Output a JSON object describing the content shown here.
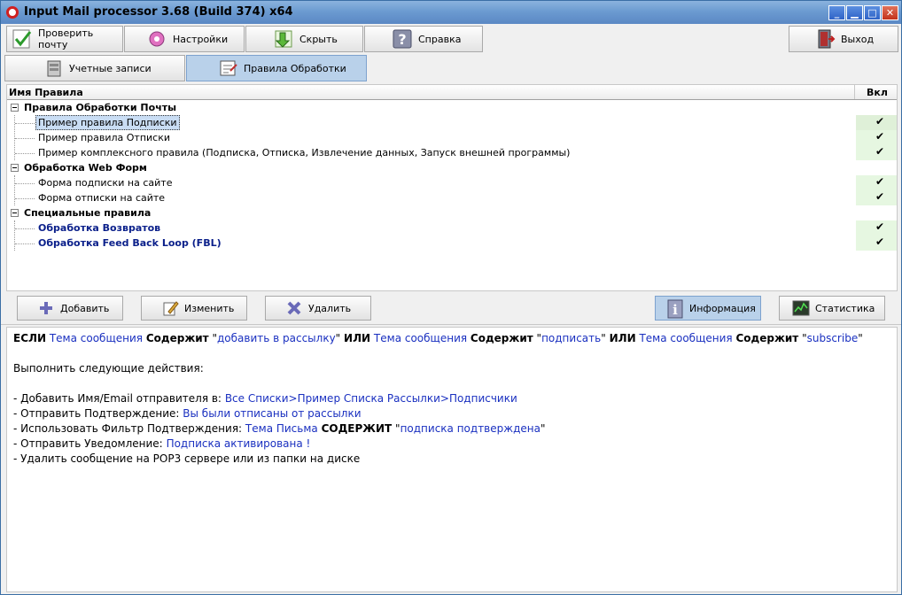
{
  "window": {
    "title": "Input Mail processor 3.68 (Build 374) x64",
    "controls": {
      "minimize": "_",
      "maximize": "□",
      "close": "✕"
    }
  },
  "toolbar": {
    "check_mail": "Проверить почту",
    "settings": "Настройки",
    "hide": "Скрыть",
    "help": "Справка",
    "exit": "Выход"
  },
  "tabs": [
    {
      "label": "Учетные записи",
      "active": false
    },
    {
      "label": "Правила Обработки",
      "active": true
    }
  ],
  "list": {
    "header": {
      "name": "Имя Правила",
      "enabled": "Вкл"
    },
    "rows": [
      {
        "kind": "group",
        "label": "Правила Обработки Почты"
      },
      {
        "kind": "child",
        "label": "Пример правила Подписки",
        "checked": true,
        "selected": true
      },
      {
        "kind": "child",
        "label": "Пример правила Отписки",
        "checked": true
      },
      {
        "kind": "child",
        "label": "Пример комплексного правила (Подписка, Отписка, Извлечение данных, Запуск внешней программы)",
        "checked": true
      },
      {
        "kind": "group",
        "label": "Обработка Web Форм"
      },
      {
        "kind": "child",
        "label": "Форма подписки на сайте",
        "checked": true
      },
      {
        "kind": "child",
        "label": "Форма отписки на сайте",
        "checked": true
      },
      {
        "kind": "group",
        "label": "Специальные правила"
      },
      {
        "kind": "special",
        "label": "Обработка Возвратов",
        "checked": true
      },
      {
        "kind": "special",
        "label": "Обработка Feed Back Loop (FBL)",
        "checked": true
      }
    ],
    "check_glyph": "✔"
  },
  "actions": {
    "add": "Добавить",
    "edit": "Изменить",
    "delete": "Удалить",
    "info": "Информация",
    "stats": "Статистика"
  },
  "detail": {
    "cond": {
      "if": "ЕСЛИ",
      "field1": "Тема сообщения",
      "contains1": "Содержит",
      "q1": "\"",
      "val1": "добавить в рассылку",
      "or1": "ИЛИ",
      "field2": "Тема сообщения",
      "contains2": "Содержит",
      "val2": "подписать",
      "or2": "ИЛИ",
      "field3": "Тема сообщения",
      "contains3": "Содержит",
      "val3": "subscribe"
    },
    "actions_title": "Выполнить следующие действия:",
    "a1_label": "- Добавить Имя/Email отправителя в:",
    "a1_value": "Все Списки>Пример Списка Рассылки>Подписчики",
    "a2_label": "- Отправить Подтверждение:",
    "a2_value": "Вы были отписаны от рассылки",
    "a3_label": "- Использовать Фильтр Подтверждения:",
    "a3_field": "Тема Письма",
    "a3_op": "СОДЕРЖИТ",
    "a3_value": "подписка подтверждена",
    "a4_label": "- Отправить Уведомление:",
    "a4_value": "Подписка активирована !",
    "a5_label": "- Удалить сообщение на POP3 сервере или из папки на диске"
  },
  "colors": {
    "accent": "#b9d1ea",
    "link_text": "#1a30c0",
    "checked_cell": "#e6f7e1"
  }
}
